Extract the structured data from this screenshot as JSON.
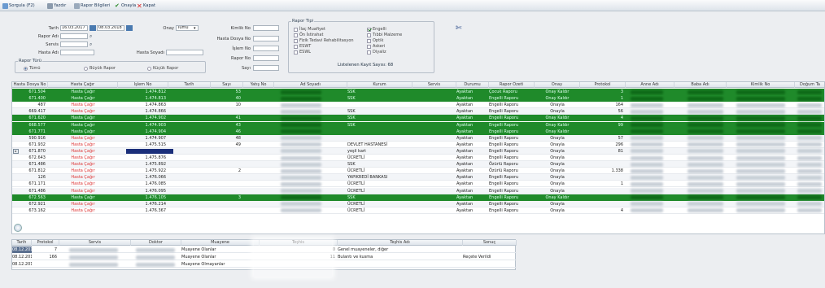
{
  "toolbar": {
    "items": [
      {
        "label": "Sorgula (F2)",
        "icon": "search-icon"
      },
      {
        "label": "Yazdır",
        "icon": "print-icon"
      },
      {
        "label": "Rapor Bilgileri",
        "icon": "report-icon"
      },
      {
        "label": "Onayla",
        "icon": "check-icon"
      },
      {
        "label": "Kapat",
        "icon": "close-icon"
      }
    ]
  },
  "filter": {
    "tarih_label": "Tarih",
    "date_from": "16.03.2017",
    "date_to": "08.03.2018",
    "onay_label": "Onay",
    "onay_value": "Tümü",
    "rapor_adi_label": "Rapor Adı",
    "servis_label": "Servis",
    "hasta_adi_label": "Hasta Adı",
    "hasta_soyadi_label": "Hasta Soyadı",
    "kimlik_label": "Kimlik No",
    "dosya_label": "Hasta Dosya No",
    "islem_label": "İşlem No",
    "rapor_no_label": "Rapor No",
    "sayi_label": "Sayı",
    "rapor_turu": {
      "title": "Rapor Türü",
      "options": [
        "Tümü",
        "Büyük Rapor",
        "Küçük Rapor"
      ],
      "selected": "Tümü"
    },
    "rapor_tipi": {
      "title": "Rapor Tipi",
      "col1": [
        "İlaç Muafiyet",
        "Ön İstirahat",
        "Fizik Tedavi Rehabilitasyon",
        "ESWT",
        "ESWL"
      ],
      "col2": [
        "Engelli",
        "Tıbbi Malzeme",
        "Optik",
        "Askeri",
        "Diyaliz"
      ],
      "checked": [
        "Engelli"
      ]
    },
    "listed_count": "Listelenen Kayıt Sayısı: 68"
  },
  "grid": {
    "columns": [
      "Hasta Dosya No",
      "Hasta Çağır",
      "İşlem No",
      "Tarih",
      "Sayı",
      "Yatış No",
      "Ad Soyadı",
      "Kurum",
      "Servis",
      "Durumu",
      "Rapor Özeti",
      "Onay",
      "Protokol",
      "Anne Adı",
      "Baba Adı",
      "Kimlik No",
      "Doğum Ta"
    ],
    "rows": [
      {
        "dosya": "671.504",
        "cagir": "Hasta Çağır",
        "islem": "1.474.812",
        "sayi": "53",
        "kurum": "SSK",
        "durum": "Ayaktan",
        "ozet": "Çocuk Raporu",
        "onay": "Onay Kaldır",
        "protokol": "3",
        "green": true
      },
      {
        "dosya": "671.400",
        "cagir": "Hasta Çağır",
        "islem": "1.474.813",
        "sayi": "40",
        "kurum": "SSK",
        "durum": "Ayaktan",
        "ozet": "Engelli Raporu",
        "onay": "Onay Kaldır",
        "protokol": "1",
        "green": true
      },
      {
        "dosya": "487",
        "cagir": "Hasta Çağır",
        "islem": "1.474.863",
        "sayi": "10",
        "kurum": "",
        "durum": "Ayaktan",
        "ozet": "Engelli Raporu",
        "onay": "Onayla",
        "protokol": "164",
        "green": false
      },
      {
        "dosya": "669.417",
        "cagir": "Hasta Çağır",
        "islem": "1.474.866",
        "sayi": "",
        "kurum": "SSK",
        "durum": "Ayaktan",
        "ozet": "Engelli Raporu",
        "onay": "Onayla",
        "protokol": "56",
        "green": false
      },
      {
        "dosya": "671.620",
        "cagir": "Hasta Çağır",
        "islem": "1.474.902",
        "sayi": "41",
        "kurum": "SSK",
        "durum": "Ayaktan",
        "ozet": "Engelli Raporu",
        "onay": "Onay Kaldır",
        "protokol": "4",
        "green": true
      },
      {
        "dosya": "668.577",
        "cagir": "Hasta Çağır",
        "islem": "1.474.903",
        "sayi": "43",
        "kurum": "SSK",
        "durum": "Ayaktan",
        "ozet": "Engelli Raporu",
        "onay": "Onay Kaldır",
        "protokol": "99",
        "green": true
      },
      {
        "dosya": "671.771",
        "cagir": "Hasta Çağır",
        "islem": "1.474.904",
        "sayi": "46",
        "kurum": "",
        "durum": "Ayaktan",
        "ozet": "Engelli Raporu",
        "onay": "Onay Kaldır",
        "protokol": "",
        "green": true
      },
      {
        "dosya": "590.916",
        "cagir": "Hasta Çağır",
        "islem": "1.474.907",
        "sayi": "48",
        "kurum": "",
        "durum": "Ayaktan",
        "ozet": "Engelli Raporu",
        "onay": "Onayla",
        "protokol": "57",
        "green": false
      },
      {
        "dosya": "671.932",
        "cagir": "Hasta Çağır",
        "islem": "1.475.515",
        "sayi": "49",
        "kurum": "DEVLET HASTANESİ",
        "durum": "Ayaktan",
        "ozet": "Engelli Raporu",
        "onay": "Onayla",
        "protokol": "296",
        "green": false
      },
      {
        "dosya": "671.870",
        "cagir": "Hasta Çağır",
        "islem": "1.475.721",
        "sayi": "",
        "kurum": "yeşil kart",
        "durum": "Ayaktan",
        "ozet": "Engelli Raporu",
        "onay": "Onayla",
        "protokol": "81",
        "green": false,
        "selected": true
      },
      {
        "dosya": "672.643",
        "cagir": "Hasta Çağır",
        "islem": "1.475.876",
        "sayi": "",
        "kurum": "ÜCRETLİ",
        "durum": "Ayaktan",
        "ozet": "Engelli Raporu",
        "onay": "Onayla",
        "protokol": "",
        "green": false
      },
      {
        "dosya": "671.486",
        "cagir": "Hasta Çağır",
        "islem": "1.475.892",
        "sayi": "",
        "kurum": "SSK",
        "durum": "Ayaktan",
        "ozet": "Özürlü Raporu",
        "onay": "Onayla",
        "protokol": "",
        "green": false
      },
      {
        "dosya": "671.812",
        "cagir": "Hasta Çağır",
        "islem": "1.475.922",
        "sayi": "2",
        "kurum": "ÜCRETLİ",
        "durum": "Ayaktan",
        "ozet": "Özürlü Raporu",
        "onay": "Onayla",
        "protokol": "1.338",
        "green": false
      },
      {
        "dosya": "126",
        "cagir": "Hasta Çağır",
        "islem": "1.476.066",
        "sayi": "",
        "kurum": "YAPIKREDİ BANKASI",
        "durum": "Ayaktan",
        "ozet": "Engelli Raporu",
        "onay": "Onayla",
        "protokol": "",
        "green": false
      },
      {
        "dosya": "671.171",
        "cagir": "Hasta Çağır",
        "islem": "1.476.085",
        "sayi": "",
        "kurum": "ÜCRETLİ",
        "durum": "Ayaktan",
        "ozet": "Engelli Raporu",
        "onay": "Onayla",
        "protokol": "1",
        "green": false
      },
      {
        "dosya": "671.486",
        "cagir": "Hasta Çağır",
        "islem": "1.476.095",
        "sayi": "",
        "kurum": "ÜCRETLİ",
        "durum": "Ayaktan",
        "ozet": "Engelli Raporu",
        "onay": "Onayla",
        "protokol": "",
        "green": false
      },
      {
        "dosya": "672.563",
        "cagir": "Hasta Çağır",
        "islem": "1.476.105",
        "sayi": "3",
        "kurum": "SSK",
        "durum": "Ayaktan",
        "ozet": "Engelli Raporu",
        "onay": "Onay Kaldır",
        "protokol": "",
        "green": true
      },
      {
        "dosya": "672.921",
        "cagir": "Hasta Çağır",
        "islem": "1.476.214",
        "sayi": "",
        "kurum": "ÜCRETLİ",
        "durum": "Ayaktan",
        "ozet": "Engelli Raporu",
        "onay": "Onayla",
        "protokol": "",
        "green": false
      },
      {
        "dosya": "673.162",
        "cagir": "Hasta Çağır",
        "islem": "1.476.367",
        "sayi": "",
        "kurum": "ÜCRETLİ",
        "durum": "Ayaktan",
        "ozet": "Engelli Raporu",
        "onay": "Onayla",
        "protokol": "4",
        "green": false
      }
    ]
  },
  "bottom": {
    "columns": [
      "Tarih",
      "Protokol",
      "Servis",
      "Doktor",
      "Muayene",
      "Teşhis",
      "Teşhis Adı",
      "Sonuç"
    ],
    "rows": [
      {
        "tarih": "08.12.2017",
        "protokol": "7",
        "muayene": "Muayene Olanlar",
        "teshis": "0",
        "teshis_adi": "Genel muayeneler, diğer",
        "sonuc": ""
      },
      {
        "tarih": "08.12.2017",
        "protokol": "166",
        "muayene": "Muayene Olanlar",
        "teshis": "11",
        "teshis_adi": "Bulantı ve kusma",
        "sonuc": "Reçete Verildi"
      },
      {
        "tarih": "08.12.2017",
        "protokol": "",
        "muayene": "Muayene Olmayanlar",
        "teshis": "",
        "teshis_adi": "",
        "sonuc": ""
      }
    ]
  },
  "colors": {
    "approved_row": "#1f8a2a",
    "call_text": "#dd3333",
    "selection": "#1b2f7a"
  }
}
